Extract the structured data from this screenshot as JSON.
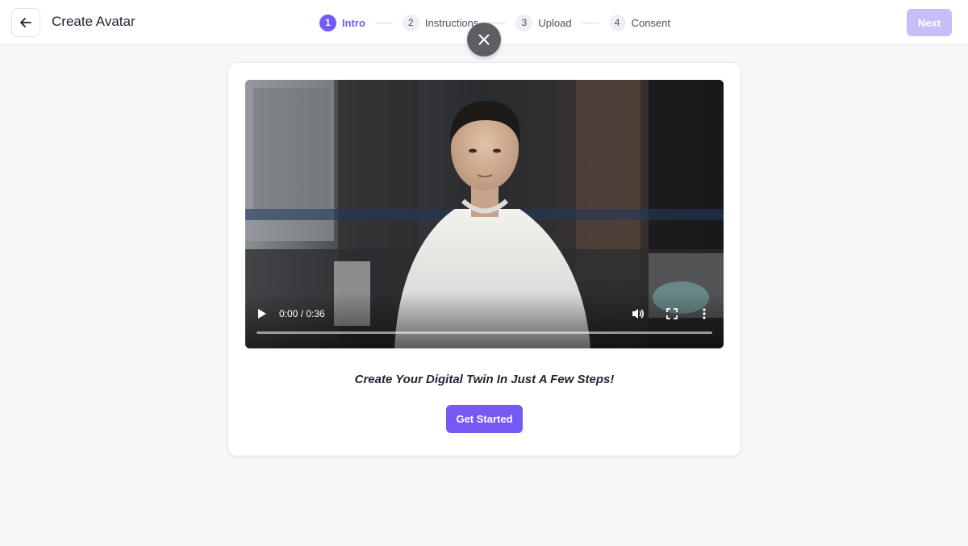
{
  "header": {
    "title": "Create Avatar",
    "next_label": "Next",
    "steps": [
      {
        "num": "1",
        "label": "Intro",
        "active": true
      },
      {
        "num": "2",
        "label": "Instructions",
        "active": false
      },
      {
        "num": "3",
        "label": "Upload",
        "active": false
      },
      {
        "num": "4",
        "label": "Consent",
        "active": false
      }
    ]
  },
  "video": {
    "time": "0:00 / 0:36",
    "progress": 0
  },
  "main": {
    "tagline": "Create Your Digital Twin In Just A Few Steps!",
    "cta_label": "Get Started"
  },
  "colors": {
    "accent": "#7559f2",
    "accent_disabled": "#c9bdf9",
    "background": "#f6f7f9"
  },
  "icons": {
    "back": "arrow-left-icon",
    "close": "close-icon",
    "play": "play-icon",
    "volume": "volume-icon",
    "fullscreen": "fullscreen-icon",
    "more": "more-vertical-icon"
  }
}
